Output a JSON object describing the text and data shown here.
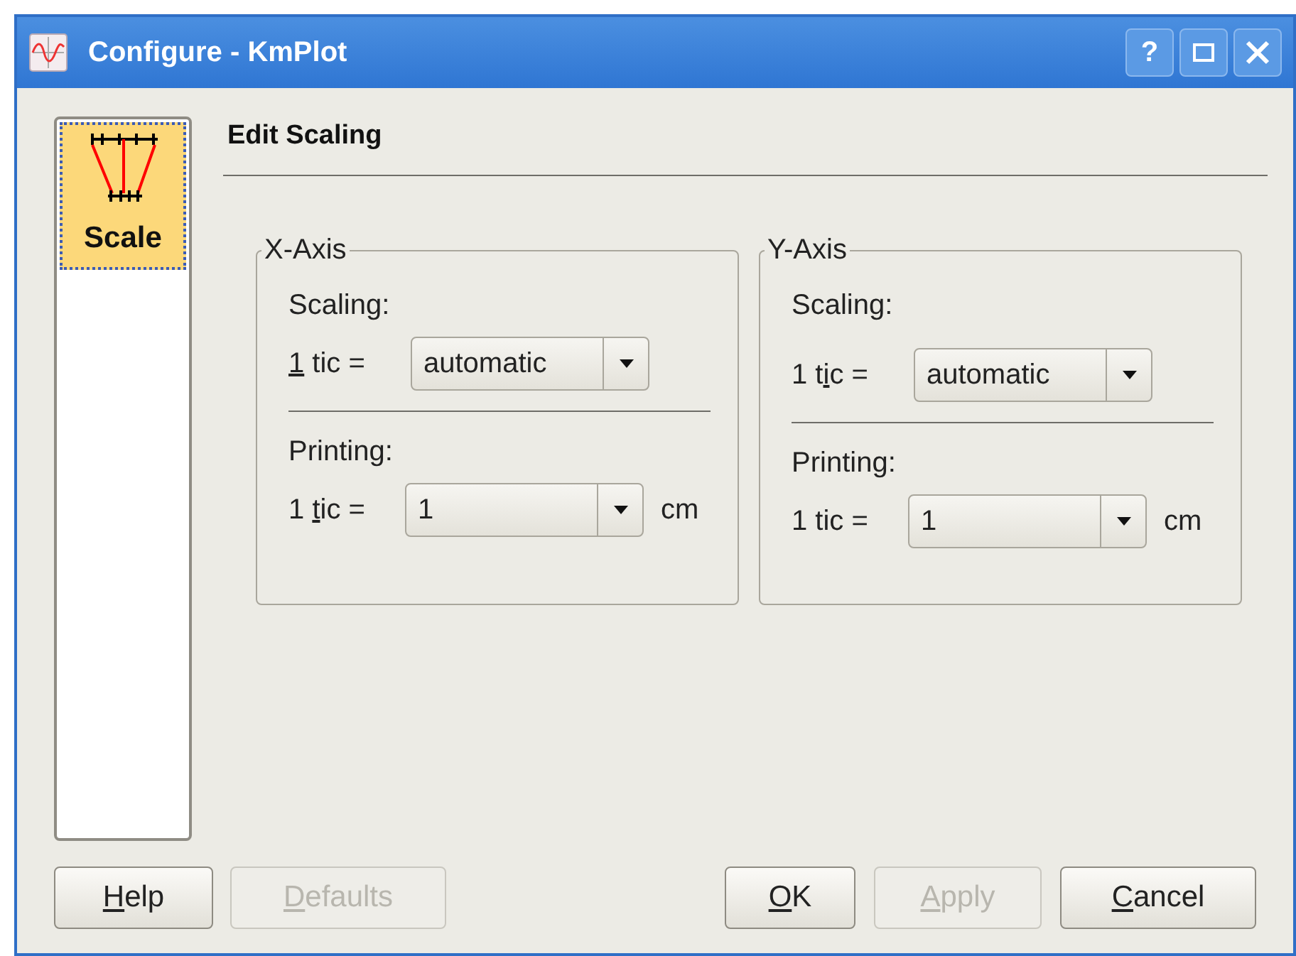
{
  "window": {
    "title": "Configure - KmPlot",
    "controls": [
      {
        "kind": "help",
        "label": "?"
      },
      {
        "kind": "maximize"
      },
      {
        "kind": "close"
      }
    ]
  },
  "sidebar": {
    "items": [
      {
        "label": "Scale",
        "selected": true
      }
    ]
  },
  "page": {
    "title": "Edit Scaling",
    "groups": [
      {
        "title": "X-Axis",
        "scaling_label": "Scaling:",
        "scaling_tic": {
          "key": "1",
          "after": " tic ="
        },
        "scaling_value": "automatic",
        "printing_label": "Printing:",
        "printing_tic": {
          "before": "1 ",
          "key": "t",
          "after": "ic ="
        },
        "printing_value": "1",
        "printing_unit": "cm"
      },
      {
        "title": "Y-Axis",
        "scaling_label": "Scaling:",
        "scaling_tic": {
          "before": "1 t",
          "key": "i",
          "after": "c ="
        },
        "scaling_value": "automatic",
        "printing_label": "Printing:",
        "printing_tic": {
          "before": "1 tic ="
        },
        "printing_value": "1",
        "printing_unit": "cm"
      }
    ]
  },
  "left_buttons": [
    {
      "label": {
        "key": "H",
        "after": "elp"
      },
      "disabled": false
    },
    {
      "label": {
        "key": "D",
        "after": "efaults"
      },
      "disabled": true
    }
  ],
  "right_buttons": [
    {
      "label": {
        "key": "O",
        "after": "K"
      },
      "disabled": false
    },
    {
      "label": {
        "key": "A",
        "after": "pply"
      },
      "disabled": true
    },
    {
      "label": {
        "key": "C",
        "after": "ancel"
      },
      "disabled": false
    }
  ]
}
